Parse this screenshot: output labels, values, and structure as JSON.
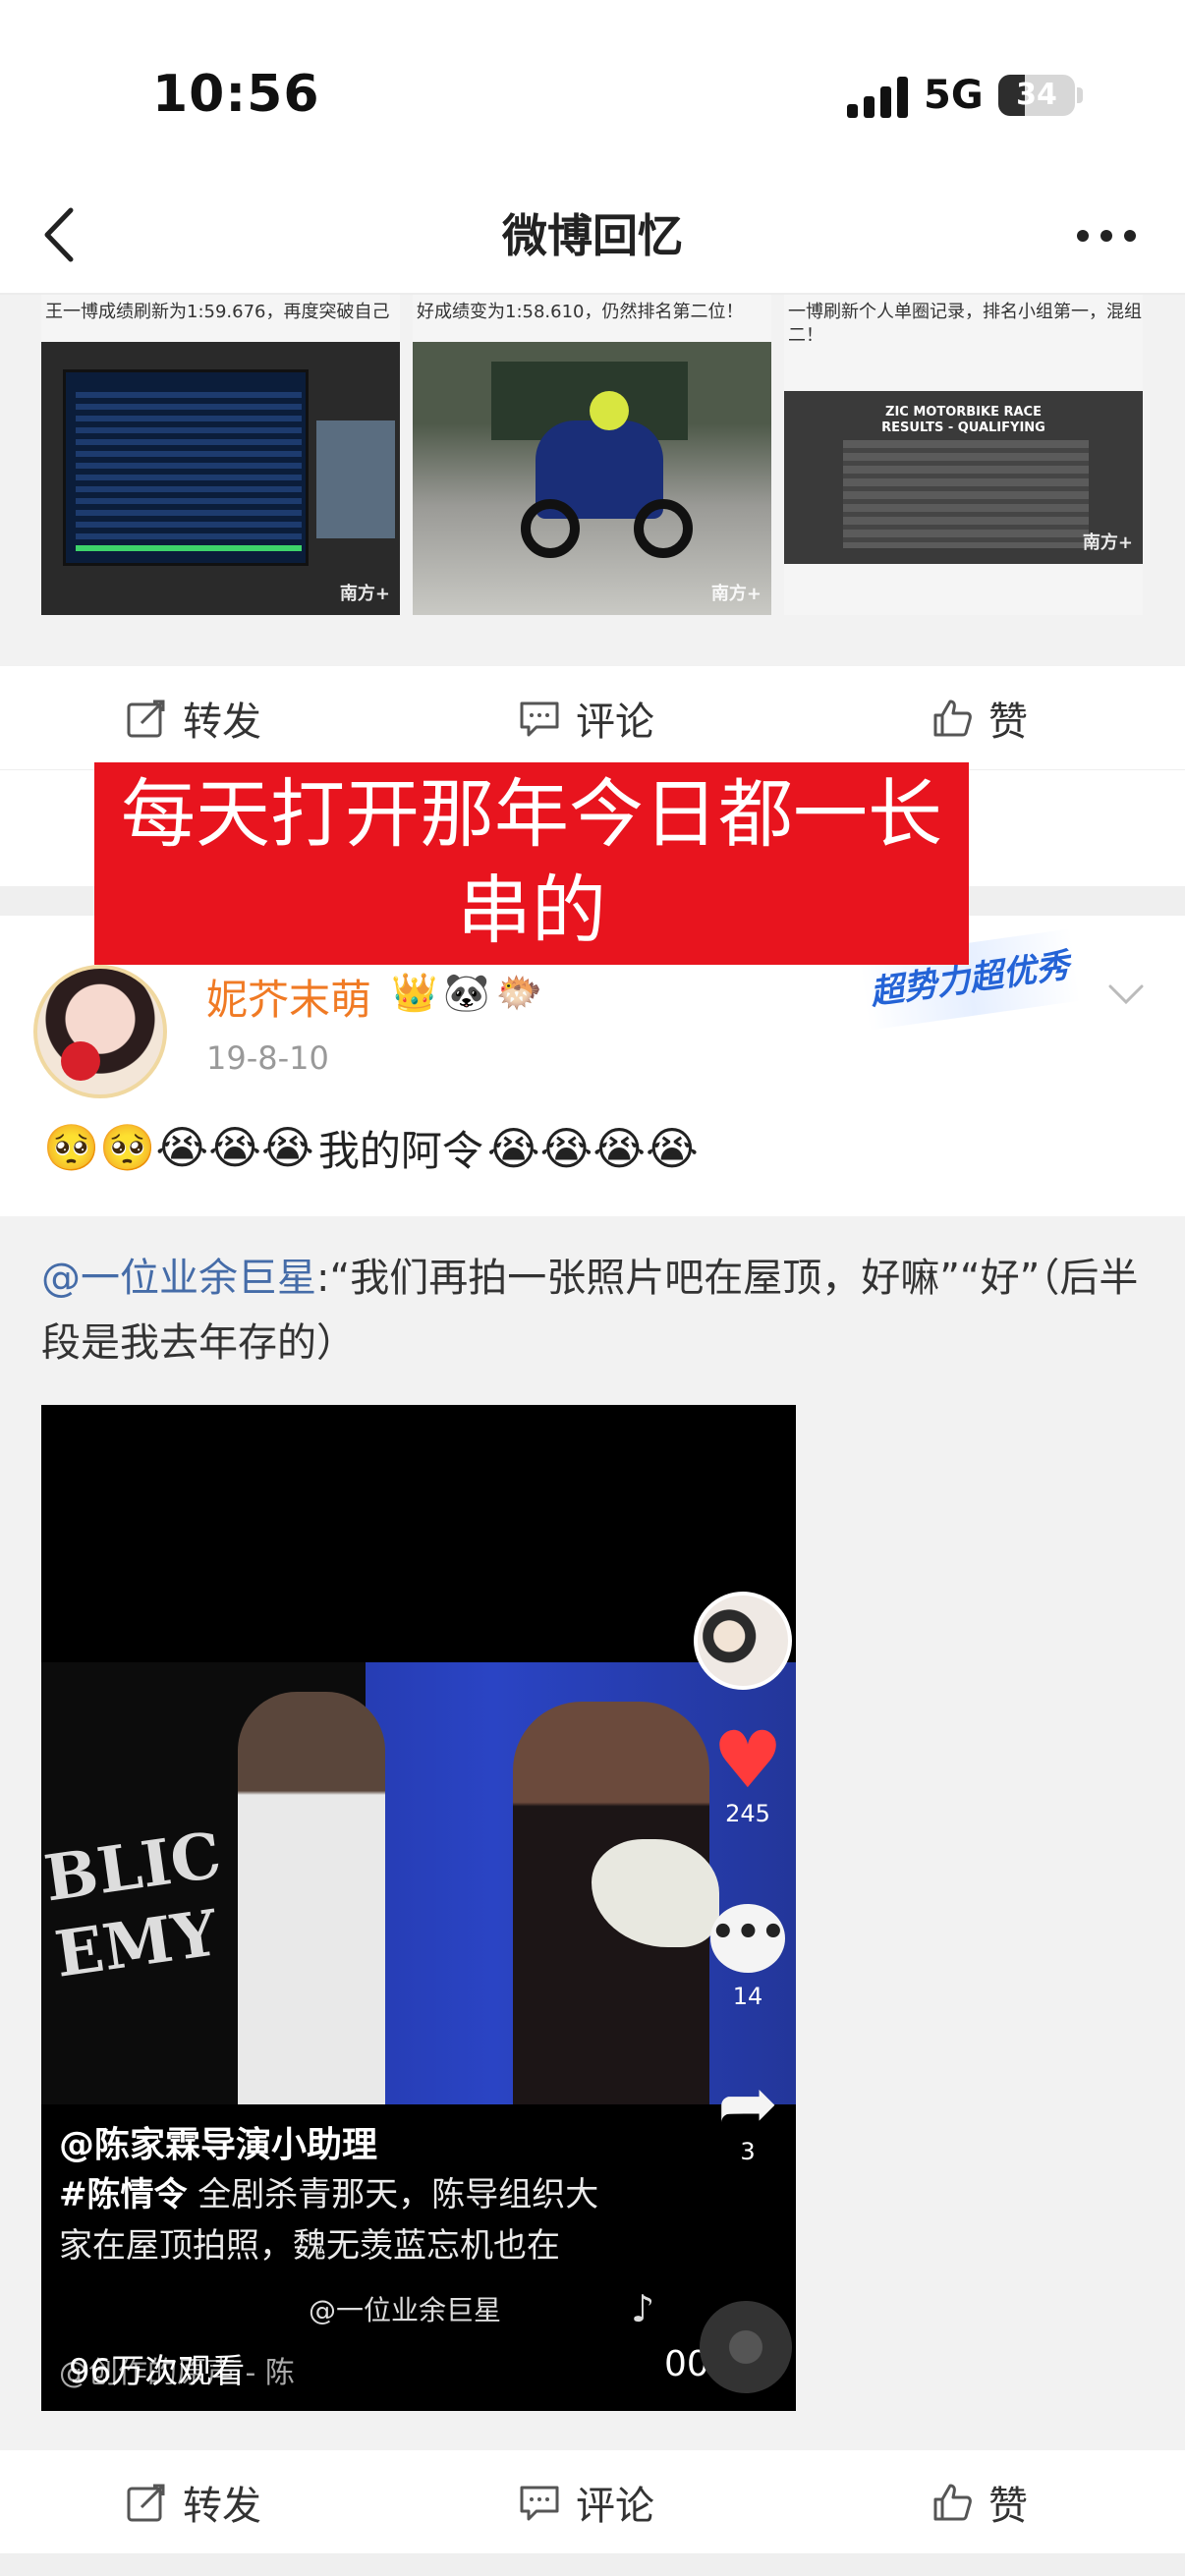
{
  "status_bar": {
    "time": "10:56",
    "network": "5G",
    "battery": "34",
    "battery_level": 0.34
  },
  "nav": {
    "title": "微博回忆"
  },
  "post1": {
    "images": [
      {
        "caption": "王一博成绩刷新为1:59.676，再度突破自己",
        "watermark": "南方+"
      },
      {
        "caption": "好成绩变为1:58.610，仍然排名第二位！",
        "watermark": "南方+"
      },
      {
        "caption": "一博刷新个人单圈记录，排名小组第一，混组二！",
        "watermark": "南方+",
        "board_title": "ZIC MOTORBIKE RACE",
        "board_subtitle": "RESULTS - QUALIFYING"
      }
    ],
    "actions": {
      "repost": "转发",
      "comment": "评论",
      "like": "赞"
    }
  },
  "banner": {
    "text": "每天打开那年今日都一长串的"
  },
  "post2": {
    "username": "妮芥末萌",
    "badges": [
      "👑",
      "🐼",
      "🐡"
    ],
    "date": "19-8-10",
    "super_badge": "超势力超优秀",
    "text_before": "🥺🥺😭😭😭",
    "text": "我的阿令",
    "text_after": "😭😭😭😭"
  },
  "repost": {
    "mention": "@一位业余巨星",
    "text": ":“我们再拍一张照片吧在屋顶，好嘛”“好”（后半段是我去年存的）",
    "video": {
      "shirt_text": "BLIC EMY",
      "author": "@陈家霖导演小助理",
      "hashtag": "#陈情令",
      "desc": " 全剧杀青那天，陈导组织大家在屋顶拍照，魏无羡蓝忘机也在",
      "handle": "@一位业余巨星",
      "music": "@创作的原声 - 陈",
      "views": "96万次观看",
      "duration": "00:06",
      "likes": "245",
      "comments": "14",
      "shares": "3"
    },
    "actions": {
      "repost": "转发",
      "comment": "评论",
      "like": "赞"
    }
  },
  "colors": {
    "banner": "#e8141e",
    "username": "#f07a24",
    "mention": "#456ca8",
    "heart": "#ff3b3b"
  }
}
